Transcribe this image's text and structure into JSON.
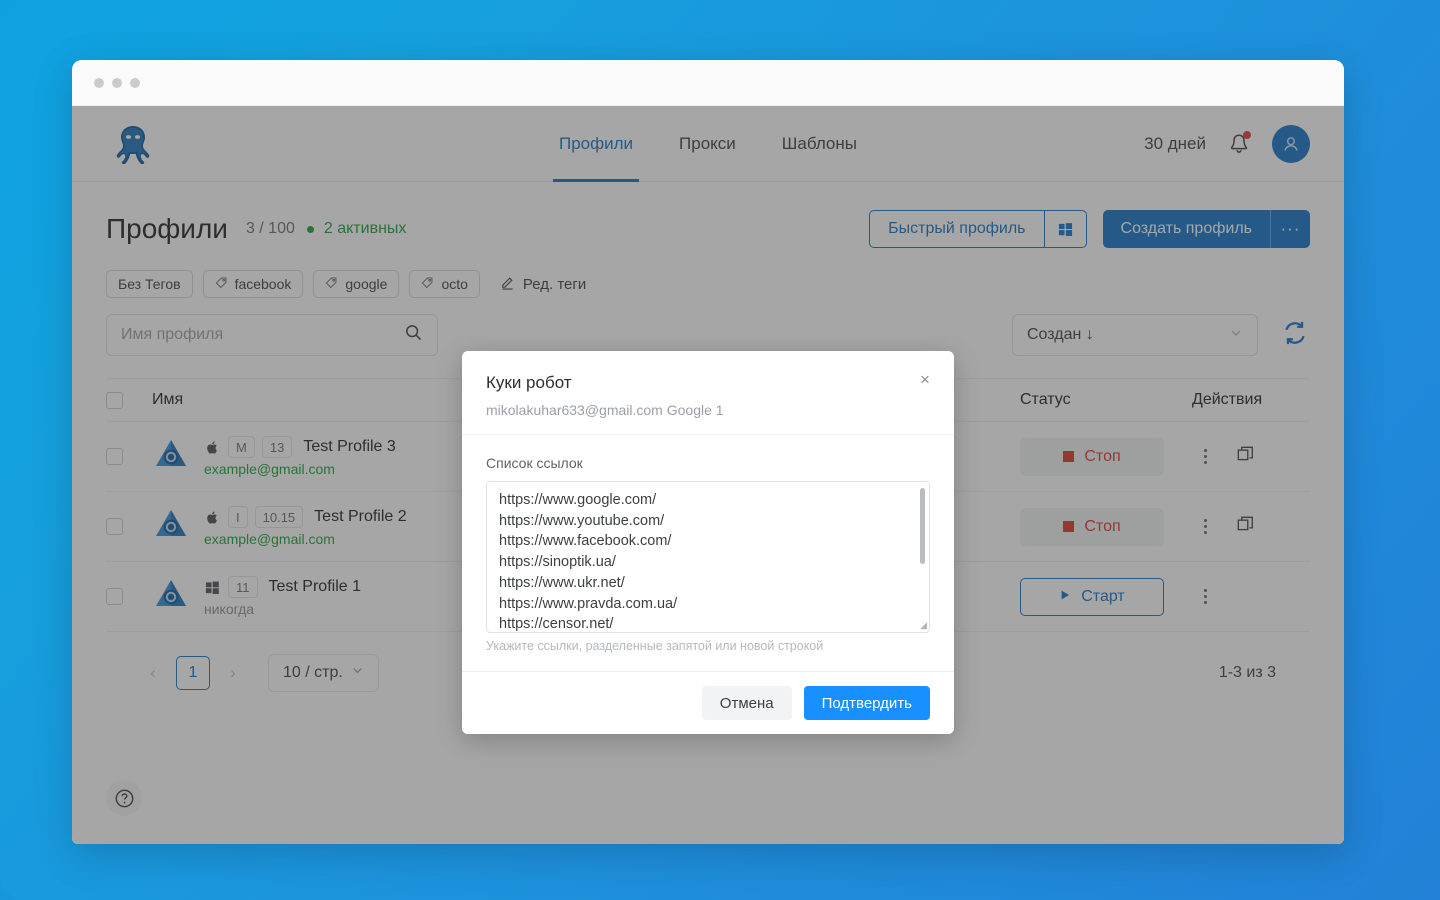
{
  "window": {
    "dots": 3
  },
  "nav": {
    "logo": "octopus-logo",
    "links": [
      {
        "label": "Профили",
        "active": true
      },
      {
        "label": "Прокси",
        "active": false
      },
      {
        "label": "Шаблоны",
        "active": false
      }
    ],
    "days": "30 дней",
    "bell": "bell-icon",
    "avatar": "user-avatar"
  },
  "page": {
    "title": "Профили",
    "count": "3 / 100",
    "active_label": "2 активных",
    "active_color": "#1aa235",
    "quick_profile": "Быстрый профиль",
    "create_profile": "Создать профиль",
    "create_more": "···"
  },
  "tags": {
    "items": [
      "Без Тегов",
      "facebook",
      "google",
      "octo"
    ],
    "edit_label": "Ред. теги"
  },
  "filters": {
    "search_placeholder": "Имя профиля",
    "search_value": "",
    "sort_value": "Создан ↓",
    "refresh": "refresh-icon"
  },
  "table": {
    "columns": {
      "name": "Имя",
      "status": "Статус",
      "actions": "Действия"
    },
    "rows": [
      {
        "os": "apple",
        "badges": [
          "M",
          "13"
        ],
        "name": "Test Profile 3",
        "sub": "example@gmail.com",
        "sub_kind": "email",
        "status": "Стоп",
        "status_kind": "stop",
        "has_clone": true
      },
      {
        "os": "apple",
        "badges": [
          "I",
          "10.15"
        ],
        "name": "Test Profile 2",
        "sub": "example@gmail.com",
        "sub_kind": "email",
        "status": "Стоп",
        "status_kind": "stop",
        "has_clone": true
      },
      {
        "os": "windows",
        "badges": [
          "11"
        ],
        "name": "Test Profile 1",
        "sub": "никогда",
        "sub_kind": "never",
        "status": "Старт",
        "status_kind": "start",
        "has_clone": false
      }
    ]
  },
  "pagination": {
    "prev": "‹",
    "page": "1",
    "next": "›",
    "page_size": "10 / стр.",
    "total": "1-3 из 3"
  },
  "help": {
    "label": "?"
  },
  "modal": {
    "title": "Куки робот",
    "subtitle": "mikolakuhar633@gmail.com Google 1",
    "close": "×",
    "field_label": "Список ссылок",
    "links": [
      "https://www.google.com/",
      "https://www.youtube.com/",
      "https://www.facebook.com/",
      "https://sinoptik.ua/",
      "https://www.ukr.net/",
      "https://www.pravda.com.ua/",
      "https://censor.net/"
    ],
    "hint": "Укажите ссылки, разделенные запятой или новой строкой",
    "cancel": "Отмена",
    "confirm": "Подтвердить",
    "confirm_color": "#1890ff"
  }
}
